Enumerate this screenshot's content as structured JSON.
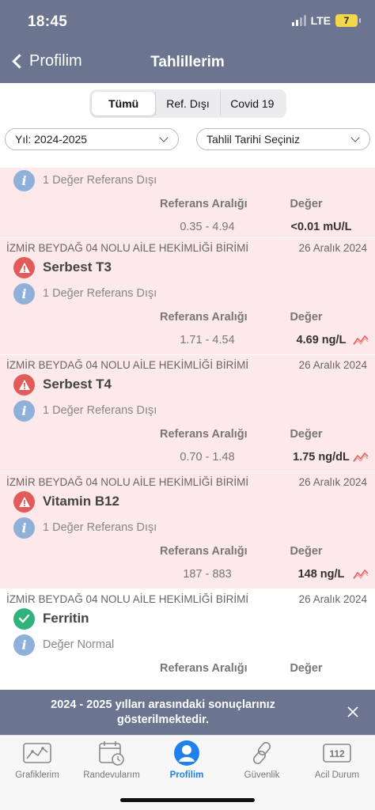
{
  "status_bar": {
    "time": "18:45",
    "network": "LTE",
    "battery": "7"
  },
  "nav": {
    "back_label": "Profilim",
    "title": "Tahlillerim"
  },
  "segments": [
    "Tümü",
    "Ref. Dışı",
    "Covid 19"
  ],
  "filters": {
    "year": "Yıl: 2024-2025",
    "date": "Tahlil Tarihi Seçiniz"
  },
  "labels": {
    "ref_range": "Referans Aralığı",
    "value": "Değer"
  },
  "results": [
    {
      "status": "alert",
      "info": "1 Değer Referans Dışı",
      "ref_range": "0.35 - 4.94",
      "value": "<0.01 mU/L"
    },
    {
      "status": "alert",
      "institution": "İZMİR BEYDAĞ 04 NOLU AİLE HEKİMLİĞİ BİRİMİ",
      "date": "26 Aralık 2024",
      "test": "Serbest T3",
      "info": "1 Değer Referans Dışı",
      "ref_range": "1.71 - 4.54",
      "value": "4.69 ng/L"
    },
    {
      "status": "alert",
      "institution": "İZMİR BEYDAĞ 04 NOLU AİLE HEKİMLİĞİ BİRİMİ",
      "date": "26 Aralık 2024",
      "test": "Serbest T4",
      "info": "1 Değer Referans Dışı",
      "ref_range": "0.70 - 1.48",
      "value": "1.75 ng/dL"
    },
    {
      "status": "alert",
      "institution": "İZMİR BEYDAĞ 04 NOLU AİLE HEKİMLİĞİ BİRİMİ",
      "date": "26 Aralık 2024",
      "test": "Vitamin B12",
      "info": "1 Değer Referans Dışı",
      "ref_range": "187 - 883",
      "value": "148 ng/L"
    },
    {
      "status": "ok",
      "institution": "İZMİR BEYDAĞ 04 NOLU AİLE HEKİMLİĞİ BİRİMİ",
      "date": "26 Aralık 2024",
      "test": "Ferritin",
      "info": "Değer Normal"
    }
  ],
  "toast": {
    "message": "2024 - 2025 yılları arasındaki sonuçlarınız gösterilmektedir."
  },
  "tabs": [
    {
      "label": "Grafiklerim",
      "icon": "chart-icon"
    },
    {
      "label": "Randevularım",
      "icon": "calendar-icon"
    },
    {
      "label": "Profilim",
      "icon": "profile-icon"
    },
    {
      "label": "Güvenlik",
      "icon": "link-icon"
    },
    {
      "label": "Acil Durum",
      "icon": "emergency-112-icon",
      "badge": "112"
    }
  ],
  "colors": {
    "header": "#6b7590",
    "alert_bg": "#fde8ea",
    "warning": "#e35a5a",
    "ok": "#2fb37a",
    "info": "#8fb0d8",
    "active_tab": "#2080ee"
  }
}
